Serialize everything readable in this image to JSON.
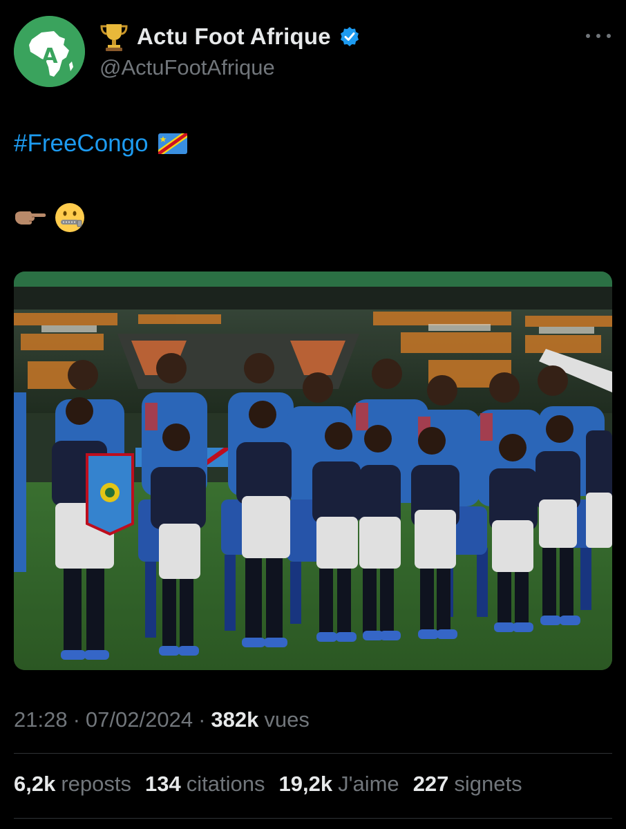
{
  "author": {
    "display_name": "Actu Foot Afrique",
    "handle": "@ActuFootAfrique",
    "avatar_icon": "africa-map-logo-icon",
    "name_prefix_icon": "trophy-icon",
    "verified_icon": "verified-badge-icon",
    "avatar_color": "#3aa35d"
  },
  "post": {
    "hashtag": "#FreeCongo",
    "hashtag_flag_icon": "drc-flag-icon",
    "emoji_line_icons": [
      "pointing-right-hand-icon",
      "zipper-mouth-face-icon"
    ],
    "media_icon": "photo-drc-team-anthem-icon"
  },
  "meta": {
    "time": "21:28",
    "separator": "·",
    "date": "07/02/2024",
    "views_count": "382k",
    "views_label": "vues"
  },
  "stats": [
    {
      "count": "6,2k",
      "label": "reposts"
    },
    {
      "count": "134",
      "label": "citations"
    },
    {
      "count": "19,2k",
      "label": "J'aime"
    },
    {
      "count": "227",
      "label": "signets"
    }
  ],
  "colors": {
    "background": "#000000",
    "link": "#1d9bf0",
    "text_primary": "#e7e9ea",
    "text_secondary": "#71767b",
    "divider": "#2f3336"
  }
}
